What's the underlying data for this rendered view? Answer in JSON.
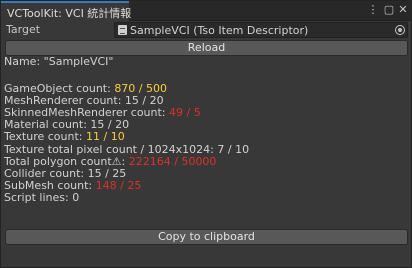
{
  "window": {
    "tab_title": "VCToolKit: VCI 統計情報",
    "menu_icon": "⋮",
    "maximize_icon": "▢",
    "close_icon": "✕"
  },
  "target": {
    "label": "Target",
    "value": "SampleVCI (Tso Item Descriptor)"
  },
  "reload_button": "Reload",
  "name_line": "Name: \"SampleVCI\"",
  "stats": [
    {
      "label": "GameObject count: ",
      "value": "870 / 500",
      "status": "warning"
    },
    {
      "label": "MeshRenderer count: ",
      "value": "15 / 20",
      "status": "ok"
    },
    {
      "label": "SkinnedMeshRenderer count: ",
      "value": "49 / 5",
      "status": "error"
    },
    {
      "label": "Material count: ",
      "value": "15 / 20",
      "status": "ok"
    },
    {
      "label": "Texture count: ",
      "value": "11 / 10",
      "status": "warning"
    },
    {
      "label": "Texture total pixel count / 1024x1024: ",
      "value": "7 / 10",
      "status": "ok"
    },
    {
      "label": "Total polygon count⚠: ",
      "value": "222164 / 50000",
      "status": "error"
    },
    {
      "label": "Collider count: ",
      "value": "15 / 25",
      "status": "ok"
    },
    {
      "label": "SubMesh count: ",
      "value": "148 / 25",
      "status": "error"
    },
    {
      "label": "Script lines: ",
      "value": "0",
      "status": "ok"
    }
  ],
  "copy_button": "Copy to clipboard",
  "colors": {
    "ok": "#d2d2d2",
    "warning": "#f4d03f",
    "error": "#d8332c"
  }
}
